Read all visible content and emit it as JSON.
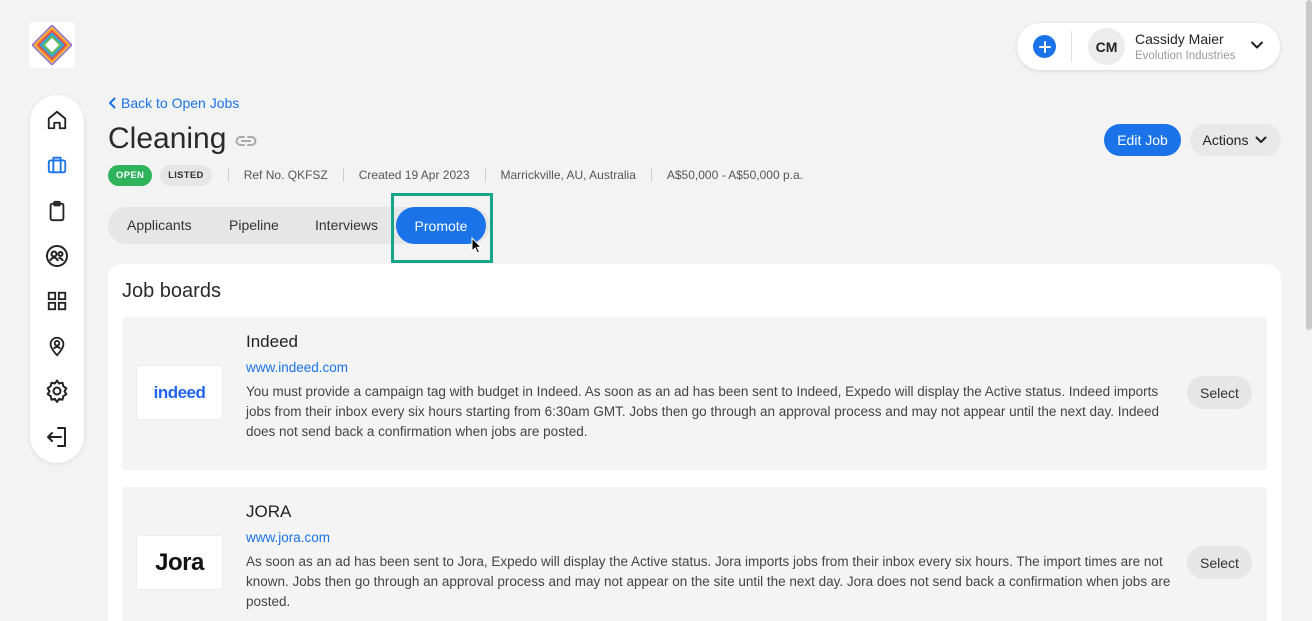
{
  "user": {
    "initials": "CM",
    "name": "Cassidy Maier",
    "company": "Evolution Industries"
  },
  "sidebar": {
    "items": [
      {
        "icon": "home-icon"
      },
      {
        "icon": "briefcase-icon",
        "active": true
      },
      {
        "icon": "clipboard-icon"
      },
      {
        "icon": "users-icon"
      },
      {
        "icon": "grid-icon"
      },
      {
        "icon": "location-icon"
      },
      {
        "icon": "gear-icon"
      },
      {
        "icon": "logout-icon"
      }
    ]
  },
  "header": {
    "back_label": "Back to Open Jobs",
    "job_title": "Cleaning",
    "status_open": "OPEN",
    "status_listed": "LISTED",
    "ref": "Ref No. QKFSZ",
    "created": "Created 19 Apr 2023",
    "location": "Marrickville, AU, Australia",
    "salary": "A$50,000 - A$50,000 p.a.",
    "edit_label": "Edit Job",
    "actions_label": "Actions"
  },
  "tabs": {
    "applicants": "Applicants",
    "pipeline": "Pipeline",
    "interviews": "Interviews",
    "promote": "Promote",
    "active": "Promote"
  },
  "job_boards": {
    "title": "Job boards",
    "boards": [
      {
        "name": "Indeed",
        "url": "www.indeed.com",
        "logo_text": "indeed",
        "description": "You must provide a campaign tag with budget in Indeed. As soon as an ad has been sent to Indeed, Expedo will display the Active status. Indeed imports jobs from their inbox every six hours starting from 6:30am GMT. Jobs then go through an approval process and may not appear until the next day. Indeed does not send back a confirmation when jobs are posted.",
        "select_label": "Select"
      },
      {
        "name": "JORA",
        "url": "www.jora.com",
        "logo_text": "Jora",
        "description": "As soon as an ad has been sent to Jora, Expedo will display the Active status. Jora imports jobs from their inbox every six hours. The import times are not known. Jobs then go through an approval process and may not appear on the site until the next day. Jora does not send back a confirmation when jobs are posted.",
        "select_label": "Select"
      }
    ]
  },
  "colors": {
    "accent": "#1a73e8",
    "open_badge": "#2eb35a",
    "highlight": "#17a589"
  }
}
